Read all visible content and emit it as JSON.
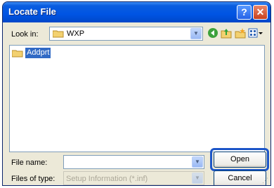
{
  "window": {
    "title": "Locate File"
  },
  "title_buttons": {
    "help": "?",
    "close": "✕"
  },
  "lookin": {
    "label": "Look in:",
    "value": "WXP"
  },
  "toolbar": {
    "back_icon": "back-icon",
    "up_icon": "up-folder-icon",
    "new_icon": "new-folder-icon",
    "view_icon": "view-menu-icon"
  },
  "files": [
    {
      "name": "Addprt",
      "type": "folder",
      "selected": true
    }
  ],
  "filename": {
    "label": "File name:",
    "value": ""
  },
  "filetype": {
    "label": "Files of type:",
    "value": "Setup Information (*.inf)"
  },
  "buttons": {
    "open": "Open",
    "cancel": "Cancel"
  },
  "colors": {
    "title_blue": "#0054e3",
    "selection": "#316ac5",
    "highlight_border": "#1d56c8",
    "dialog_bg": "#ece9d8"
  }
}
